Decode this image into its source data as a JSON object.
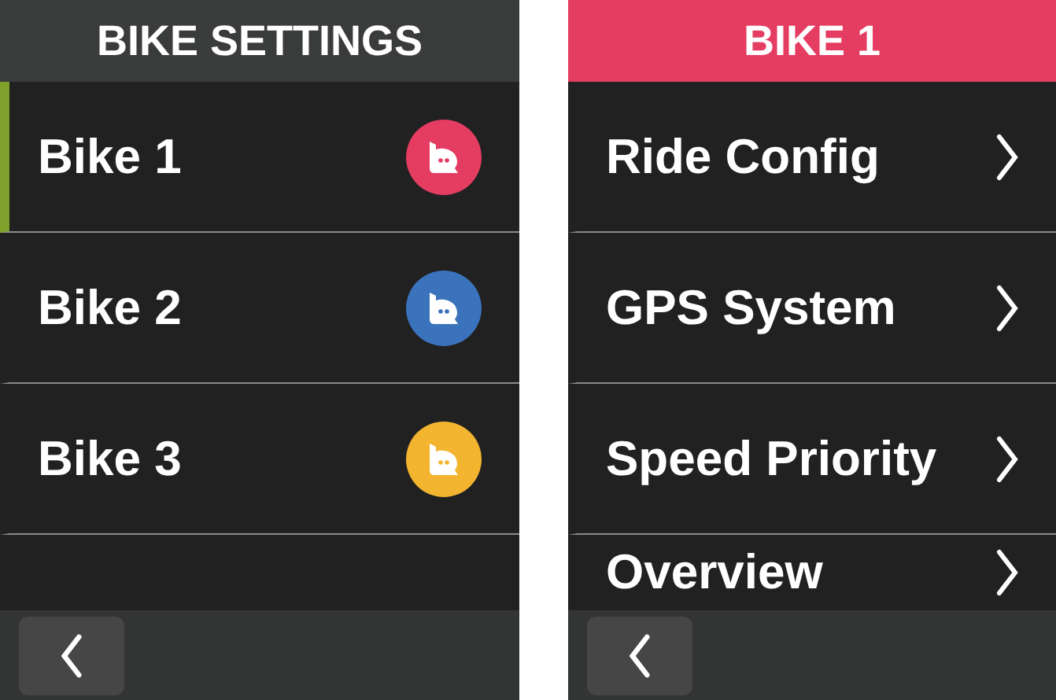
{
  "screens": [
    {
      "title": "BIKE SETTINGS",
      "color": "#3a3c3b",
      "rows": [
        {
          "kind": "bike",
          "label": "Bike 1",
          "selected": true,
          "color": "#e53c62"
        },
        {
          "kind": "bike",
          "label": "Bike 2",
          "selected": false,
          "color": "#3a72bb"
        },
        {
          "kind": "bike",
          "label": "Bike 3",
          "selected": false,
          "color": "#f3b52f"
        }
      ]
    },
    {
      "title": "BIKE 1",
      "color": "#e53c62",
      "rows": [
        {
          "kind": "menu",
          "label": "Ride Config",
          "selected": false
        },
        {
          "kind": "menu",
          "label": "GPS System",
          "selected": false
        },
        {
          "kind": "menu",
          "label": "Speed Priority",
          "selected": false
        },
        {
          "kind": "menu",
          "label": "Overview",
          "selected": false
        }
      ]
    }
  ]
}
